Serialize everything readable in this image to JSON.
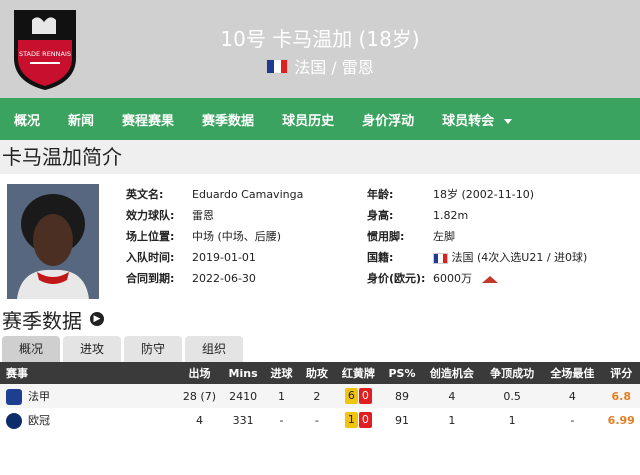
{
  "header": {
    "title": "10号 卡马温加 (18岁)",
    "nationality_club": "法国 / 雷恩",
    "club_logo_text": "STADE RENNAIS",
    "flag_colors": [
      "#1f3a93",
      "#ffffff",
      "#e02020"
    ]
  },
  "nav": {
    "items": [
      "概况",
      "新闻",
      "赛程赛果",
      "赛季数据",
      "球员历史",
      "身价浮动",
      "球员转会"
    ]
  },
  "profile": {
    "title": "卡马温加简介",
    "left": [
      {
        "label": "英文名:",
        "value": "Eduardo Camavinga"
      },
      {
        "label": "效力球队:",
        "value": "雷恩"
      },
      {
        "label": "场上位置:",
        "value": "中场 (中场、后腰)"
      },
      {
        "label": "入队时间:",
        "value": "2019-01-01"
      },
      {
        "label": "合同到期:",
        "value": "2022-06-30"
      }
    ],
    "right": [
      {
        "label": "年龄:",
        "value": "18岁 (2002-11-10)"
      },
      {
        "label": "身高:",
        "value": "1.82m"
      },
      {
        "label": "惯用脚:",
        "value": "左脚"
      },
      {
        "label": "国籍:",
        "value": "法国 (4次入选U21 / 进0球)"
      },
      {
        "label": "身价(欧元):",
        "value": "6000万"
      }
    ]
  },
  "season": {
    "title": "赛季数据",
    "tabs": [
      "概况",
      "进攻",
      "防守",
      "组织"
    ],
    "columns": [
      "赛事",
      "出场",
      "Mins",
      "进球",
      "助攻",
      "红黄牌",
      "PS%",
      "创造机会",
      "争顶成功",
      "全场最佳",
      "评分"
    ],
    "rows": [
      {
        "competition": "法甲",
        "apps": "28 (7)",
        "mins": "2410",
        "goals": "1",
        "assists": "2",
        "yellow": "6",
        "red": "0",
        "ps": "89",
        "chances": "4",
        "aerials": "0.5",
        "motm": "4",
        "rating": "6.8",
        "icon_color": "#1d3f8f"
      },
      {
        "competition": "欧冠",
        "apps": "4",
        "mins": "331",
        "goals": "-",
        "assists": "-",
        "yellow": "1",
        "red": "0",
        "ps": "91",
        "chances": "1",
        "aerials": "1",
        "motm": "-",
        "rating": "6.99",
        "icon_color": "#0b2d6b"
      }
    ]
  }
}
